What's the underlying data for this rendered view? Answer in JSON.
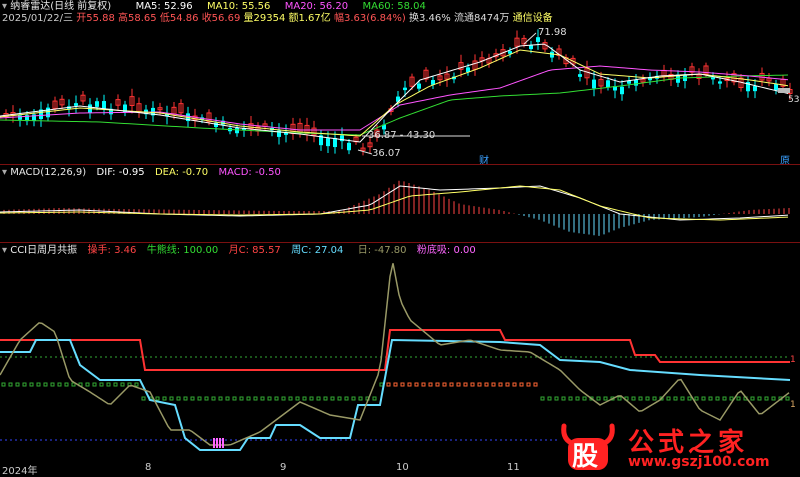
{
  "header": {
    "title": "纳睿雷达(日线 前复权)",
    "ma": [
      {
        "label": "MA5: 52.96",
        "color": "#ffffff"
      },
      {
        "label": "MA10: 55.56",
        "color": "#ffff66"
      },
      {
        "label": "MA20: 56.20",
        "color": "#ff55ff"
      },
      {
        "label": "MA60: 58.04",
        "color": "#33dd33"
      }
    ],
    "date": "2025/01/22/三",
    "open": "开55.88",
    "high": "高58.65",
    "low": "低54.86",
    "close": "收56.69",
    "volume": "量29354",
    "amount": "额1.67亿",
    "change": "幅3.63(6.84%)",
    "turnover": "换3.46%",
    "float": "流通8474万",
    "industry": "通信设备"
  },
  "price_annotations": {
    "high_value": "71.98",
    "low_value": "36.07",
    "range_text": "36.87 - 43.30",
    "marker_cai": "财",
    "marker_yuan": "原",
    "right_value": "53"
  },
  "macd": {
    "title": "MACD(12,26,9)",
    "dif": "DIF: -0.95",
    "dea": "DEA: -0.70",
    "macd": "MACD: -0.50"
  },
  "cci": {
    "title": "CCI日周月共振",
    "items": [
      {
        "label": "操手: 3.46",
        "color": "#ff4444"
      },
      {
        "label": "牛熊线: 100.00",
        "color": "#33dd33"
      },
      {
        "label": "月C: 85.57",
        "color": "#ff4444"
      },
      {
        "label": "周C: 27.04",
        "color": "#66ddff"
      },
      {
        "label": "日: -47.80",
        "color": "#999966"
      },
      {
        "label": "粉底吸: 0.00",
        "color": "#ff66ff"
      }
    ],
    "right_label_1": "1",
    "right_label_2": "1"
  },
  "x_axis": {
    "labels": [
      "2024年",
      "8",
      "9",
      "10",
      "11"
    ]
  },
  "watermark": {
    "logo_char": "股",
    "brand": "公式之家",
    "url": "www.gszj100.com"
  },
  "colors": {
    "up": "#ff3333",
    "down": "#00ffff",
    "separator": "#7a1010",
    "brand_red": "#ff2222"
  }
}
